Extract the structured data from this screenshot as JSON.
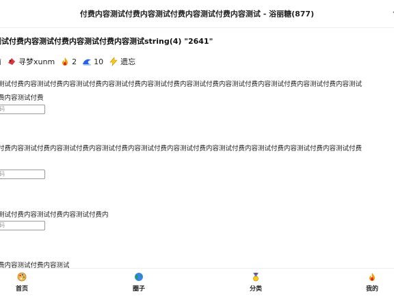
{
  "header": {
    "title": "付费内容测试付费内容测试付费内容测试付费内容测试 - 浴丽糖(877)",
    "more_glyph": "‹"
  },
  "post": {
    "title": "测试付费内容测试付费内容测试付费内容测试string(4) \"2641\"",
    "meta": {
      "prefix": "前",
      "author": "寻梦xunm",
      "hot": "2",
      "replies": "10",
      "status": "遗忘"
    }
  },
  "blocks": [
    {
      "lines": [
        "测试付费内容测试付费内容测试付费内容测试付费内容测试付费内容测试付费内容测试付费内容测试付费内容测试付费内容测试",
        "费内容测试付费"
      ],
      "input_placeholder": "码"
    },
    {
      "lines": [
        "付费内容测试付费内容测试付费内容测试付费内容测试付费内容测试付费内容测试付费内容测试付费内容测试付费内容测试付费"
      ],
      "input_placeholder": "码"
    },
    {
      "lines": [
        "测试付费内容测试付费内容测试付费内"
      ],
      "input_placeholder": "码"
    },
    {
      "lines": [
        "费内容测试付费内容测试"
      ]
    }
  ],
  "tabbar": {
    "tabs": [
      {
        "label": "首页",
        "icon": "palette-icon"
      },
      {
        "label": "圈子",
        "icon": "globe-icon"
      },
      {
        "label": "分类",
        "icon": "medal-icon"
      },
      {
        "label": "我的",
        "icon": "flame-icon"
      }
    ]
  },
  "colors": {
    "flame": "#f59e0b",
    "wave": "#2563eb",
    "bolt": "#facc15",
    "globe": "#16a34a",
    "border": "#eeeeee"
  }
}
